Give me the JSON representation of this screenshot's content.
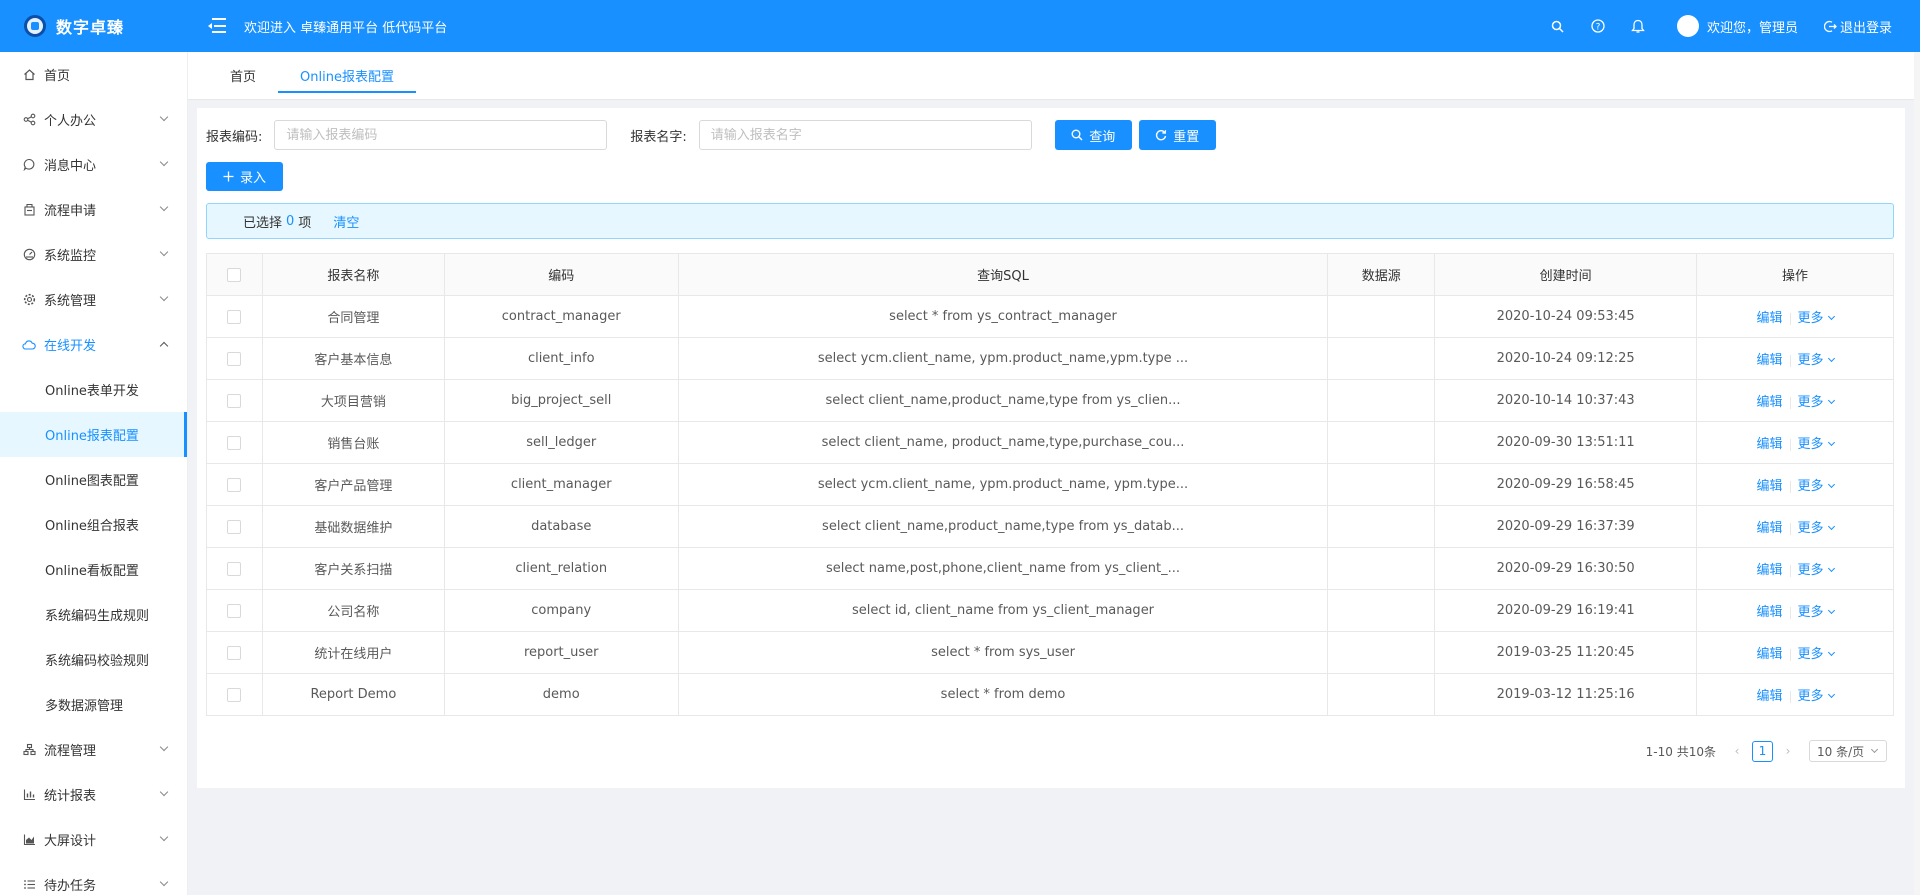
{
  "header": {
    "logo_text": "数字卓臻",
    "welcome": "欢迎进入 卓臻通用平台 低代码平台",
    "user_greeting": "欢迎您，管理员",
    "logout": "退出登录",
    "bg_color": "#1890ff"
  },
  "sidebar": {
    "items": [
      {
        "label": "首页",
        "icon": "home-icon"
      },
      {
        "label": "个人办公",
        "icon": "share-icon"
      },
      {
        "label": "消息中心",
        "icon": "message-icon"
      },
      {
        "label": "流程申请",
        "icon": "flow-icon"
      },
      {
        "label": "系统监控",
        "icon": "dashboard-icon"
      },
      {
        "label": "系统管理",
        "icon": "gear-icon"
      },
      {
        "label": "在线开发",
        "icon": "cloud-icon"
      },
      {
        "label": "流程管理",
        "icon": "cluster-icon"
      },
      {
        "label": "统计报表",
        "icon": "bar-chart-icon"
      },
      {
        "label": "大屏设计",
        "icon": "area-chart-icon"
      },
      {
        "label": "待办任务",
        "icon": "list-icon"
      }
    ],
    "online_sub": [
      {
        "label": "Online表单开发"
      },
      {
        "label": "Online报表配置"
      },
      {
        "label": "Online图表配置"
      },
      {
        "label": "Online组合报表"
      },
      {
        "label": "Online看板配置"
      },
      {
        "label": "系统编码生成规则"
      },
      {
        "label": "系统编码校验规则"
      },
      {
        "label": "多数据源管理"
      }
    ]
  },
  "tabs": [
    {
      "label": "首页"
    },
    {
      "label": "Online报表配置"
    }
  ],
  "search": {
    "code_label": "报表编码:",
    "code_placeholder": "请输入报表编码",
    "name_label": "报表名字:",
    "name_placeholder": "请输入报表名字",
    "query_button": "查询",
    "reset_button": "重置"
  },
  "toolbar": {
    "add_button": "录入"
  },
  "selection": {
    "prefix": "已选择",
    "count": "0",
    "suffix": "项",
    "clear": "清空"
  },
  "table": {
    "columns": [
      "报表名称",
      "编码",
      "查询SQL",
      "数据源",
      "创建时间",
      "操作"
    ],
    "rows": [
      {
        "name": "合同管理",
        "code": "contract_manager",
        "sql": "select * from ys_contract_manager",
        "source": "",
        "created": "2020-10-24 09:53:45"
      },
      {
        "name": "客户基本信息",
        "code": "client_info",
        "sql": "select ycm.client_name, ypm.product_name,ypm.type ...",
        "source": "",
        "created": "2020-10-24 09:12:25"
      },
      {
        "name": "大项目营销",
        "code": "big_project_sell",
        "sql": "select client_name,product_name,type from ys_clien...",
        "source": "",
        "created": "2020-10-14 10:37:43"
      },
      {
        "name": "销售台账",
        "code": "sell_ledger",
        "sql": "select client_name, product_name,type,purchase_cou...",
        "source": "",
        "created": "2020-09-30 13:51:11"
      },
      {
        "name": "客户产品管理",
        "code": "client_manager",
        "sql": "select ycm.client_name, ypm.product_name, ypm.type...",
        "source": "",
        "created": "2020-09-29 16:58:45"
      },
      {
        "name": "基础数据维护",
        "code": "database",
        "sql": "select client_name,product_name,type from ys_datab...",
        "source": "",
        "created": "2020-09-29 16:37:39"
      },
      {
        "name": "客户关系扫描",
        "code": "client_relation",
        "sql": "select name,post,phone,client_name from ys_client_...",
        "source": "",
        "created": "2020-09-29 16:30:50"
      },
      {
        "name": "公司名称",
        "code": "company",
        "sql": "select id, client_name from ys_client_manager",
        "source": "",
        "created": "2020-09-29 16:19:41"
      },
      {
        "name": "统计在线用户",
        "code": "report_user",
        "sql": "select * from sys_user",
        "source": "",
        "created": "2019-03-25 11:20:45"
      },
      {
        "name": "Report Demo",
        "code": "demo",
        "sql": "select * from demo",
        "source": "",
        "created": "2019-03-12 11:25:16"
      }
    ],
    "edit_label": "编辑",
    "more_label": "更多"
  },
  "pagination": {
    "summary": "1-10 共10条",
    "current_page": "1",
    "page_size": "10 条/页"
  }
}
